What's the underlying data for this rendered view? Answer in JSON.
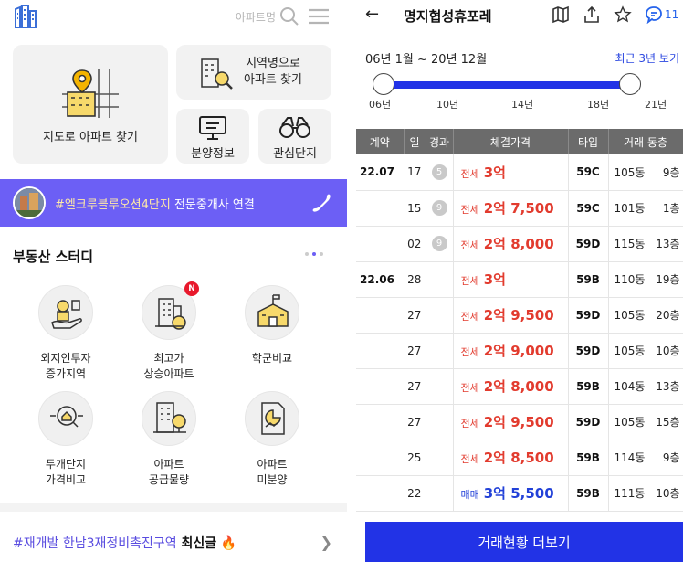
{
  "left": {
    "search_placeholder": "아파트명",
    "tiles": {
      "map": "지도로 아파트 찾기",
      "region": "지역명으로\n아파트 찾기",
      "presale": "분양정보",
      "favorites": "관심단지"
    },
    "banner": {
      "tag": "#엘크루블루오션4단지",
      "text": " 전문중개사 연결"
    },
    "study": {
      "title": "부동산 스터디",
      "items": [
        {
          "label": "외지인투자\n증가지역",
          "icon": "investor-hand-icon",
          "badge": ""
        },
        {
          "label": "최고가\n상승아파트",
          "icon": "building-coin-icon",
          "badge": "N"
        },
        {
          "label": "학군비교",
          "icon": "school-icon",
          "badge": ""
        },
        {
          "label": "두개단지\n가격비교",
          "icon": "magnifier-house-icon",
          "badge": ""
        },
        {
          "label": "아파트\n공급물량",
          "icon": "apartment-tree-icon",
          "badge": ""
        },
        {
          "label": "아파트\n미분양",
          "icon": "chart-document-icon",
          "badge": ""
        }
      ]
    },
    "news": {
      "tag": "#재개발 한남3재정비촉진구역",
      "strong": " 최신글",
      "emoji": "🔥"
    }
  },
  "right": {
    "title": "명지협성휴포레",
    "chat_count": "11",
    "period": {
      "range": "06년 1월 ~ 20년 12월",
      "link": "최근 3년 보기",
      "ticks": [
        "06년",
        "10년",
        "14년",
        "18년",
        "21년"
      ],
      "start_fraction": 0.0,
      "end_fraction": 1.0
    },
    "table": {
      "headers": [
        "계약",
        "일",
        "경과",
        "체결가격",
        "타입",
        "거래 동층"
      ],
      "rows": [
        {
          "month": "22.07",
          "day": "17",
          "elapsed": "5",
          "kind": "전세",
          "price": "3억",
          "style": "lease",
          "type": "59C",
          "dong": "105동",
          "floor": "9층"
        },
        {
          "month": "",
          "day": "15",
          "elapsed": "9",
          "kind": "전세",
          "price": "2억 7,500",
          "style": "lease",
          "type": "59C",
          "dong": "101동",
          "floor": "1층"
        },
        {
          "month": "",
          "day": "02",
          "elapsed": "9",
          "kind": "전세",
          "price": "2억 8,000",
          "style": "lease",
          "type": "59D",
          "dong": "115동",
          "floor": "13층"
        },
        {
          "month": "22.06",
          "day": "28",
          "elapsed": "",
          "kind": "전세",
          "price": "3억",
          "style": "lease",
          "type": "59B",
          "dong": "110동",
          "floor": "19층"
        },
        {
          "month": "",
          "day": "27",
          "elapsed": "",
          "kind": "전세",
          "price": "2억 9,500",
          "style": "lease",
          "type": "59D",
          "dong": "105동",
          "floor": "20층"
        },
        {
          "month": "",
          "day": "27",
          "elapsed": "",
          "kind": "전세",
          "price": "2억 9,000",
          "style": "lease",
          "type": "59D",
          "dong": "105동",
          "floor": "10층"
        },
        {
          "month": "",
          "day": "27",
          "elapsed": "",
          "kind": "전세",
          "price": "2억 8,000",
          "style": "lease",
          "type": "59B",
          "dong": "104동",
          "floor": "13층"
        },
        {
          "month": "",
          "day": "27",
          "elapsed": "",
          "kind": "전세",
          "price": "2억 9,500",
          "style": "lease",
          "type": "59D",
          "dong": "105동",
          "floor": "15층"
        },
        {
          "month": "",
          "day": "25",
          "elapsed": "",
          "kind": "전세",
          "price": "2억 8,500",
          "style": "lease",
          "type": "59B",
          "dong": "114동",
          "floor": "9층"
        },
        {
          "month": "",
          "day": "22",
          "elapsed": "",
          "kind": "매매",
          "price": "3억 5,500",
          "style": "sale",
          "type": "59B",
          "dong": "111동",
          "floor": "10층"
        }
      ]
    },
    "more_button": "거래현황 더보기"
  },
  "colors": {
    "accent_purple": "#6c5ff5",
    "primary_blue": "#2233e6",
    "lease_red": "#e23b2e",
    "sale_blue": "#2241d8",
    "badge_red": "#e8192c"
  }
}
